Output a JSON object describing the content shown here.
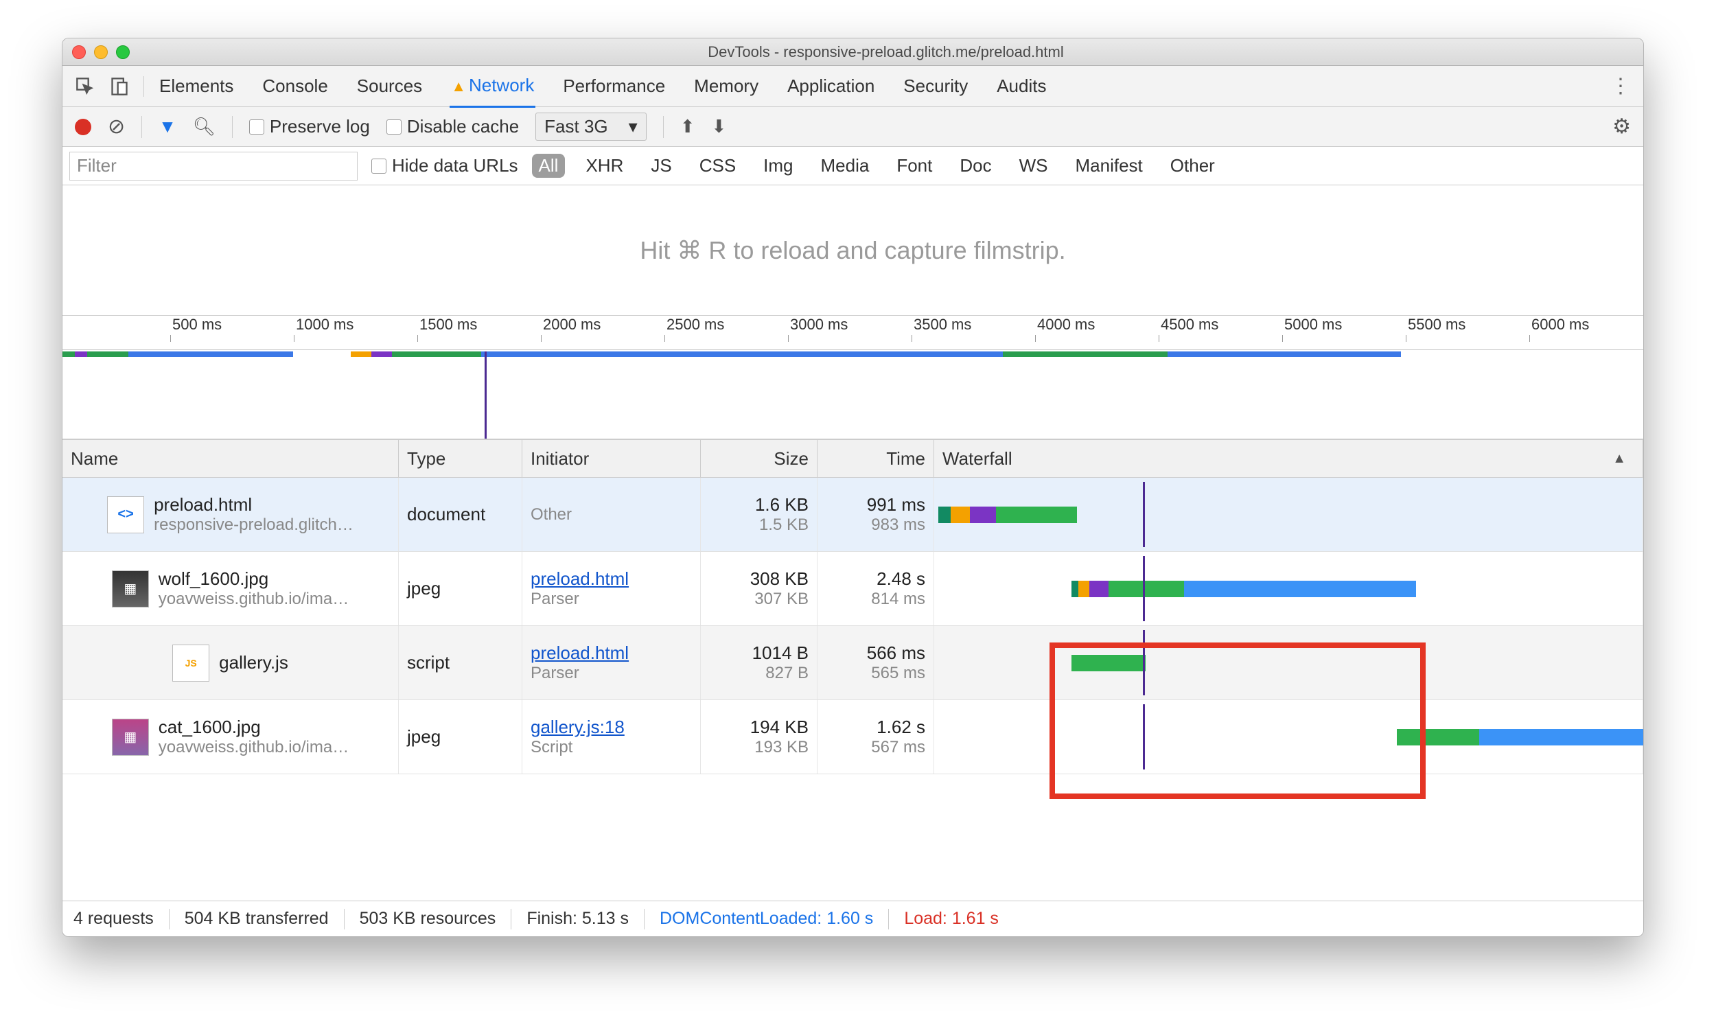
{
  "window": {
    "title": "DevTools - responsive-preload.glitch.me/preload.html"
  },
  "tabs": [
    "Elements",
    "Console",
    "Sources",
    "Network",
    "Performance",
    "Memory",
    "Application",
    "Security",
    "Audits"
  ],
  "active_tab": "Network",
  "toolbar": {
    "preserve_log": "Preserve log",
    "disable_cache": "Disable cache",
    "throttle": "Fast 3G"
  },
  "filterbar": {
    "placeholder": "Filter",
    "hide_data_urls": "Hide data URLs",
    "pills": [
      "All",
      "XHR",
      "JS",
      "CSS",
      "Img",
      "Media",
      "Font",
      "Doc",
      "WS",
      "Manifest",
      "Other"
    ],
    "active_pill": "All"
  },
  "filmstrip_msg": "Hit ⌘ R to reload and capture filmstrip.",
  "timeline": {
    "ticks": [
      "500 ms",
      "1000 ms",
      "1500 ms",
      "2000 ms",
      "2500 ms",
      "3000 ms",
      "3500 ms",
      "4000 ms",
      "4500 ms",
      "5000 ms",
      "5500 ms",
      "6000 ms"
    ]
  },
  "columns": {
    "name": "Name",
    "type": "Type",
    "initiator": "Initiator",
    "size": "Size",
    "time": "Time",
    "waterfall": "Waterfall"
  },
  "rows": [
    {
      "name": "preload.html",
      "sub": "responsive-preload.glitch…",
      "type": "document",
      "initiator": "Other",
      "init_sub": "",
      "size": "1.6 KB",
      "size_sub": "1.5 KB",
      "time": "991 ms",
      "time_sub": "983 ms",
      "icon": "html"
    },
    {
      "name": "wolf_1600.jpg",
      "sub": "yoavweiss.github.io/ima…",
      "type": "jpeg",
      "initiator": "preload.html",
      "init_sub": "Parser",
      "size": "308 KB",
      "size_sub": "307 KB",
      "time": "2.48 s",
      "time_sub": "814 ms",
      "icon": "img"
    },
    {
      "name": "gallery.js",
      "sub": "",
      "type": "script",
      "initiator": "preload.html",
      "init_sub": "Parser",
      "size": "1014 B",
      "size_sub": "827 B",
      "time": "566 ms",
      "time_sub": "565 ms",
      "icon": "js"
    },
    {
      "name": "cat_1600.jpg",
      "sub": "yoavweiss.github.io/ima…",
      "type": "jpeg",
      "initiator": "gallery.js:18",
      "init_sub": "Script",
      "size": "194 KB",
      "size_sub": "193 KB",
      "time": "1.62 s",
      "time_sub": "567 ms",
      "icon": "img"
    }
  ],
  "statusbar": {
    "requests": "4 requests",
    "transferred": "504 KB transferred",
    "resources": "503 KB resources",
    "finish": "Finish: 5.13 s",
    "dcl": "DOMContentLoaded: 1.60 s",
    "load": "Load: 1.61 s"
  }
}
